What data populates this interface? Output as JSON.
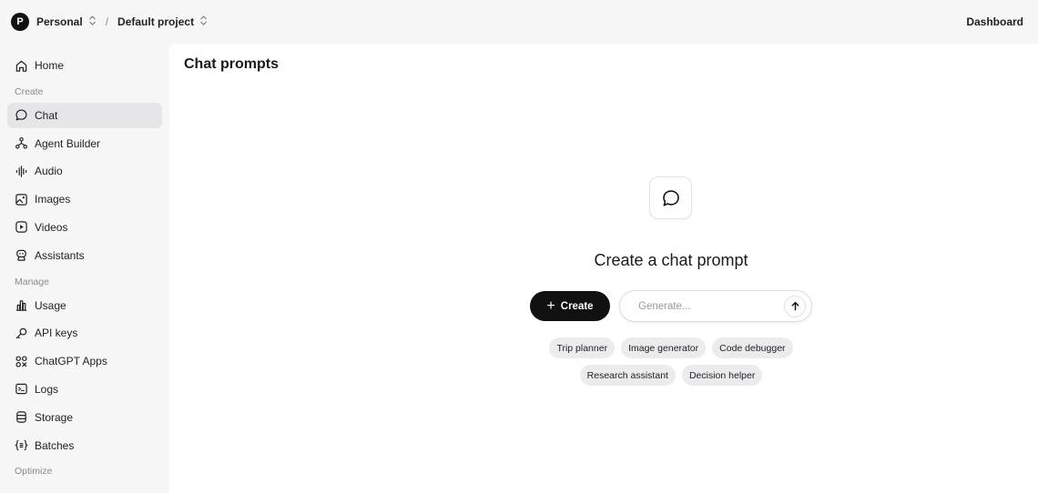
{
  "header": {
    "org_initial": "P",
    "org_name": "Personal",
    "project_name": "Default project",
    "switch_glyph": "⇳",
    "separator": "/",
    "right_link": "Dashboard"
  },
  "sidebar": {
    "home": "Home",
    "sections": {
      "create": "Create",
      "manage": "Manage",
      "optimize": "Optimize"
    },
    "create_items": [
      "Chat",
      "Agent Builder",
      "Audio",
      "Images",
      "Videos",
      "Assistants"
    ],
    "manage_items": [
      "Usage",
      "API keys",
      "ChatGPT Apps",
      "Logs",
      "Storage",
      "Batches"
    ],
    "active": "Chat"
  },
  "main": {
    "title": "Chat prompts",
    "hero": "Create a chat prompt",
    "create_label": "Create",
    "generate_placeholder": "Generate...",
    "chips_row1": [
      "Trip planner",
      "Image generator",
      "Code debugger"
    ],
    "chips_row2": [
      "Research assistant",
      "Decision helper"
    ]
  },
  "colors": {
    "accent_dark": "#111111",
    "sidebar_bg": "#f7f7f8",
    "active_item_bg": "#e6e6e8",
    "chip_bg": "#ececee"
  }
}
